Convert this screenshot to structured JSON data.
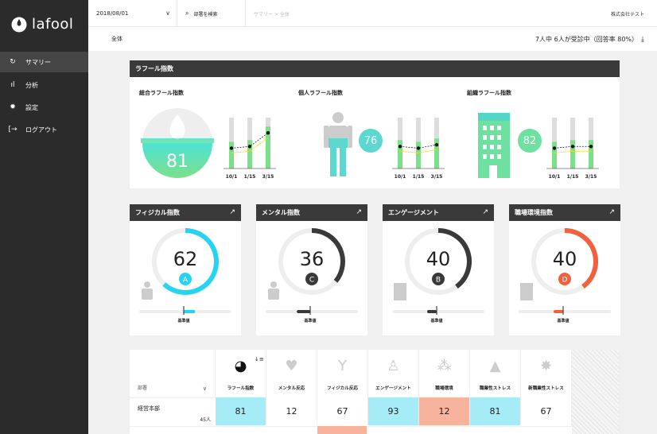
{
  "app": {
    "logo_text": "lafool"
  },
  "sidebar": {
    "items": [
      {
        "label": "サマリー",
        "icon": "refresh-icon"
      },
      {
        "label": "分析",
        "icon": "bar-chart-icon"
      },
      {
        "label": "設定",
        "icon": "gear-icon"
      },
      {
        "label": "ログアウト",
        "icon": "logout-icon"
      }
    ]
  },
  "topbar": {
    "date": "2018/08/01",
    "search_label": "部署を検索",
    "breadcrumb": "サマリー  >  全体",
    "company": "株式会社テスト"
  },
  "subbar": {
    "scope": "全体",
    "status": "7人中 6人が受診中（回答率 80%）"
  },
  "lafool_index": {
    "title": "ラフール指数",
    "sections": [
      {
        "title": "総合ラフール指数",
        "score": "81",
        "color": "#6ee0a0",
        "chart_data": {
          "type": "bar",
          "categories": [
            "10/1",
            "1/15",
            "3/15"
          ],
          "values": [
            72,
            73,
            81
          ]
        }
      },
      {
        "title": "個人ラフール指数",
        "score": "76",
        "color": "#5cd8d0",
        "chart_data": {
          "type": "bar",
          "categories": [
            "10/1",
            "1/15",
            "3/15"
          ],
          "values": [
            73,
            72,
            74
          ]
        }
      },
      {
        "title": "組織ラフール指数",
        "score": "82",
        "color": "#6ee0a0",
        "chart_data": {
          "type": "bar",
          "categories": [
            "10/1",
            "1/15",
            "3/15"
          ],
          "values": [
            72,
            73,
            73
          ]
        }
      }
    ]
  },
  "cards": [
    {
      "title": "フィジカル指数",
      "score": "62",
      "grade": "A",
      "color": "#26d3f0",
      "fraction": 0.62,
      "base_label": "基準値"
    },
    {
      "title": "メンタル指数",
      "score": "36",
      "grade": "C",
      "color": "#3a3a3a",
      "fraction": 0.36,
      "base_label": "基準値"
    },
    {
      "title": "エンゲージメント",
      "score": "40",
      "grade": "B",
      "color": "#3a3a3a",
      "fraction": 0.4,
      "base_label": "基準値"
    },
    {
      "title": "職場環境指数",
      "score": "40",
      "grade": "D",
      "color": "#f2613d",
      "fraction": 0.4,
      "base_label": "基準値"
    }
  ],
  "table": {
    "dept_header": "部署",
    "columns": [
      {
        "label": "ラフール指数",
        "icon": "pie-chart-icon"
      },
      {
        "label": "メンタル反応",
        "icon": "heart-icon"
      },
      {
        "label": "フィジカル反応",
        "icon": "person-icon"
      },
      {
        "label": "エンゲージメント",
        "icon": "chair-icon"
      },
      {
        "label": "職場環境",
        "icon": "group-icon"
      },
      {
        "label": "職業性ストレス",
        "icon": "warning-icon"
      },
      {
        "label": "新職業性ストレス",
        "icon": "burst-icon"
      }
    ],
    "rows": [
      {
        "dept": "経営本部",
        "count": "45人",
        "values": [
          "81",
          "12",
          "67",
          "93",
          "12",
          "81",
          "67"
        ],
        "highlights": [
          "#a6ecf6",
          "",
          "",
          "#a6ecf6",
          "#f7b39c",
          "#a6ecf6",
          ""
        ]
      }
    ]
  }
}
